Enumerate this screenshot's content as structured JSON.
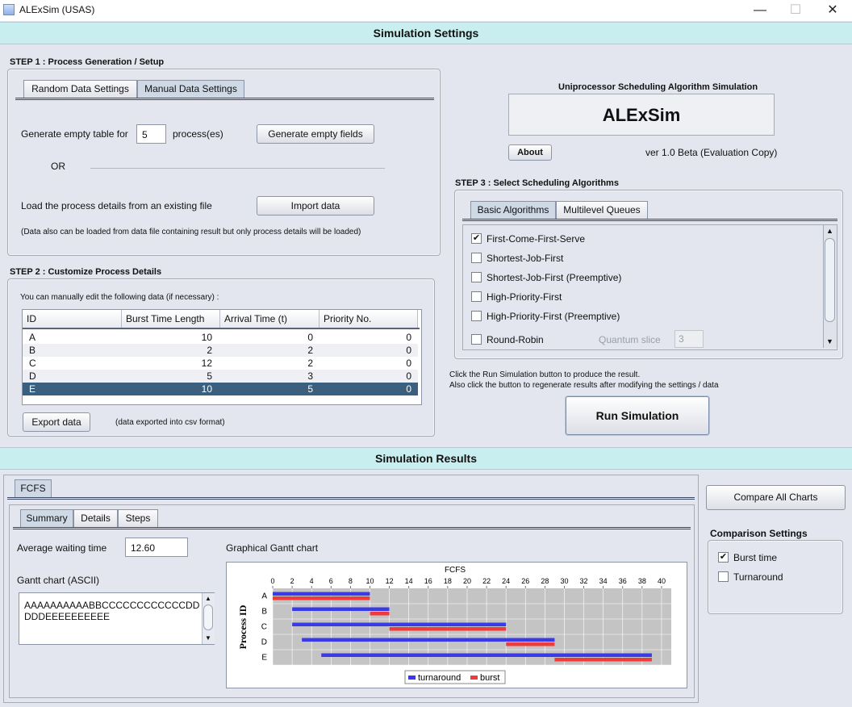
{
  "window": {
    "title": "ALExSim (USAS)",
    "minimize": "—",
    "maximize": "☐",
    "close": "✕"
  },
  "settings_header": "Simulation Settings",
  "step1": {
    "label": "STEP 1 : Process Generation / Setup",
    "tabs": [
      "Random Data Settings",
      "Manual Data Settings"
    ],
    "generate_prefix": "Generate empty table for",
    "process_count": "5",
    "generate_suffix": "process(es)",
    "generate_button": "Generate empty fields",
    "or_label": "OR",
    "load_label": "Load the process details from an existing file",
    "import_button": "Import data",
    "note": "(Data also can be loaded from data file containing result but only process details will be loaded)"
  },
  "step2": {
    "label": "STEP 2 : Customize Process Details",
    "hint": "You can manually edit the following data (if necessary) :",
    "columns": [
      "ID",
      "Burst Time Length",
      "Arrival Time (t)",
      "Priority No."
    ],
    "rows": [
      {
        "id": "A",
        "burst": "10",
        "arrival": "0",
        "priority": "0"
      },
      {
        "id": "B",
        "burst": "2",
        "arrival": "2",
        "priority": "0"
      },
      {
        "id": "C",
        "burst": "12",
        "arrival": "2",
        "priority": "0"
      },
      {
        "id": "D",
        "burst": "5",
        "arrival": "3",
        "priority": "0"
      },
      {
        "id": "E",
        "burst": "10",
        "arrival": "5",
        "priority": "0"
      }
    ],
    "export_button": "Export data",
    "export_note": "(data exported into csv format)"
  },
  "app_info": {
    "subtitle": "Uniprocessor Scheduling Algorithm Simulation",
    "name": "ALExSim",
    "about_button": "About",
    "version": "ver 1.0 Beta (Evaluation Copy)"
  },
  "step3": {
    "label": "STEP 3 : Select Scheduling Algorithms",
    "tabs": [
      "Basic Algorithms",
      "Multilevel Queues"
    ],
    "algorithms": [
      {
        "name": "First-Come-First-Serve",
        "checked": "✔"
      },
      {
        "name": "Shortest-Job-First",
        "checked": ""
      },
      {
        "name": "Shortest-Job-First (Preemptive)",
        "checked": ""
      },
      {
        "name": "High-Priority-First",
        "checked": ""
      },
      {
        "name": "High-Priority-First (Preemptive)",
        "checked": ""
      },
      {
        "name": "Round-Robin",
        "checked": ""
      }
    ],
    "quantum_label": "Quantum slice",
    "quantum_value": "3"
  },
  "run": {
    "hint1": "Click the Run Simulation button to produce the result.",
    "hint2": "Also click the button to regenerate results after modifying the settings / data",
    "button": "Run Simulation"
  },
  "results_header": "Simulation Results",
  "results": {
    "algo_tab": "FCFS",
    "sub_tabs": [
      "Summary",
      "Details",
      "Steps"
    ],
    "avg_wait_label": "Average waiting time",
    "avg_wait_value": "12.60",
    "ascii_label": "Gantt chart (ASCII)",
    "ascii_line1": "AAAAAAAAAABBCCCCCCCCCCCCDD",
    "ascii_line2": "DDDEEEEEEEEEE",
    "graphical_label": "Graphical Gantt chart",
    "compare_button": "Compare All Charts",
    "comparison_label": "Comparison Settings",
    "comparison_options": [
      {
        "name": "Burst time",
        "checked": "✔"
      },
      {
        "name": "Turnaround",
        "checked": ""
      }
    ]
  },
  "chart_data": {
    "type": "bar",
    "title": "FCFS",
    "ylabel": "Process ID",
    "categories": [
      "A",
      "B",
      "C",
      "D",
      "E"
    ],
    "xlim": [
      0,
      41
    ],
    "xticks": [
      0,
      2,
      4,
      6,
      8,
      10,
      12,
      14,
      16,
      18,
      20,
      22,
      24,
      26,
      28,
      30,
      32,
      34,
      36,
      38,
      40
    ],
    "series": [
      {
        "name": "turnaround",
        "color": "#3a3ae8",
        "ranges": [
          [
            0,
            10
          ],
          [
            2,
            12
          ],
          [
            2,
            24
          ],
          [
            3,
            29
          ],
          [
            5,
            39
          ]
        ]
      },
      {
        "name": "burst",
        "color": "#ee3b3b",
        "ranges": [
          [
            0,
            10
          ],
          [
            10,
            12
          ],
          [
            12,
            24
          ],
          [
            24,
            29
          ],
          [
            29,
            39
          ]
        ]
      }
    ],
    "grid": true,
    "legend": "bottom"
  }
}
